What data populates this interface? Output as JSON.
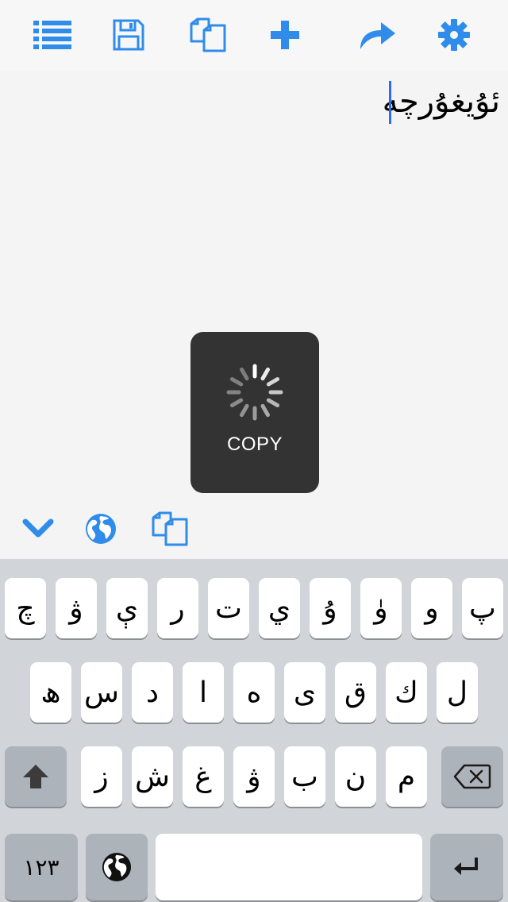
{
  "toolbar": {
    "icons": [
      "list-icon",
      "save-icon",
      "copy-icon",
      "plus-icon",
      "share-icon",
      "gear-icon"
    ],
    "accent": "#2f8ceb"
  },
  "editor": {
    "text": "ئۇيغۇرچە"
  },
  "hud": {
    "label": "COPY"
  },
  "accessory": {
    "icons": [
      "chevron-down-icon",
      "globe-icon",
      "copy-icon"
    ]
  },
  "keyboard": {
    "row1": [
      "چ",
      "ۋ",
      "ې",
      "ر",
      "ت",
      "ي",
      "ۇ",
      "ۈ",
      "و",
      "پ"
    ],
    "row2": [
      "ھ",
      "س",
      "د",
      "ا",
      "ە",
      "ى",
      "ق",
      "ك",
      "ل"
    ],
    "row3": [
      "ز",
      "ش",
      "غ",
      "ۋ",
      "ب",
      "ن",
      "م"
    ],
    "numbers_label": "١٢٣",
    "icons": [
      "shift-icon",
      "backspace-icon",
      "globe-icon",
      "return-icon"
    ]
  }
}
